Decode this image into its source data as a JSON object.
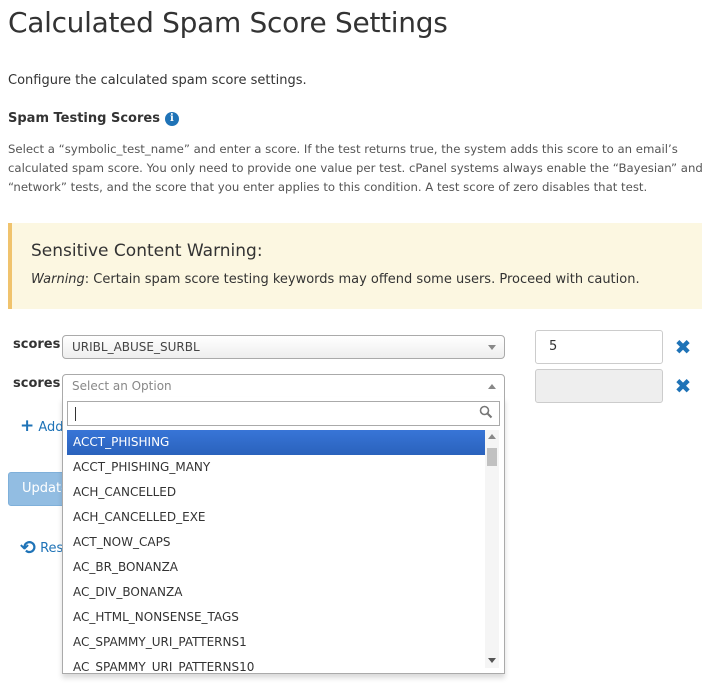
{
  "page": {
    "title": "Calculated Spam Score Settings",
    "intro": "Configure the calculated spam score settings.",
    "section_title": "Spam Testing Scores",
    "info_glyph": "i",
    "description": "Select a “symbolic_test_name” and enter a score. If the test returns true, the system adds this score to an email’s calculated spam score. You only need to provide one value per test. cPanel systems always enable the “Bayesian” and “network” tests, and the score that you enter applies to this condition. A test score of zero disables that test."
  },
  "warning": {
    "title": "Sensitive Content Warning:",
    "label": "Warning",
    "text": ": Certain spam score testing keywords may offend some users. Proceed with caution."
  },
  "rows": [
    {
      "label": "scores",
      "selected": "URIBL_ABUSE_SURBL",
      "score": "5"
    },
    {
      "label": "scores",
      "placeholder": "Select an Option",
      "score": ""
    }
  ],
  "dropdown": {
    "search_value": "",
    "options": [
      "ACCT_PHISHING",
      "ACCT_PHISHING_MANY",
      "ACH_CANCELLED",
      "ACH_CANCELLED_EXE",
      "ACT_NOW_CAPS",
      "AC_BR_BONANZA",
      "AC_DIV_BONANZA",
      "AC_HTML_NONSENSE_TAGS",
      "AC_SPAMMY_URI_PATTERNS1",
      "AC_SPAMMY_URI_PATTERNS10"
    ],
    "highlighted_index": 0
  },
  "actions": {
    "add_label": "Add",
    "update_label": "Update",
    "reset_label": "Reset"
  },
  "icons": {
    "info": "info-circle-icon",
    "remove": "times-icon",
    "add": "plus-icon",
    "reset": "undo-icon",
    "search": "search-icon"
  },
  "colors": {
    "accent": "#1f73b7",
    "warning_bg": "#fcf7e1",
    "warning_border": "#f0c36d",
    "highlight": "#3875d7"
  }
}
